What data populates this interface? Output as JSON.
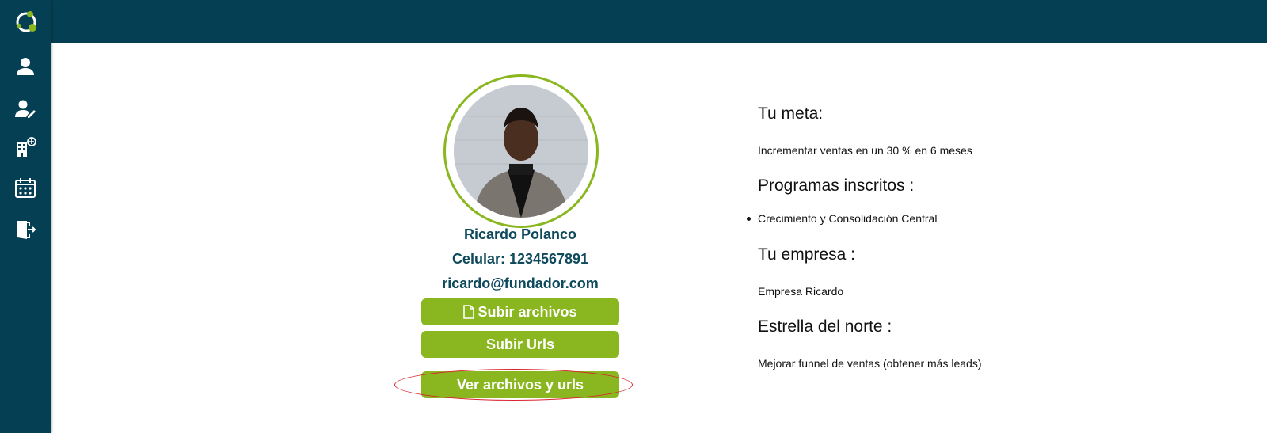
{
  "colors": {
    "brand_dark": "#053f53",
    "accent_green": "#8ab71f",
    "text_dark_teal": "#0e4a5c",
    "annotation_red": "#d9232b"
  },
  "sidebar": {
    "logo_icon": "circle-dots-logo",
    "items": [
      {
        "icon": "user-icon"
      },
      {
        "icon": "user-edit-icon"
      },
      {
        "icon": "building-add-icon"
      },
      {
        "icon": "calendar-icon"
      },
      {
        "icon": "logout-door-icon"
      }
    ]
  },
  "profile": {
    "name": "Ricardo Polanco",
    "phone": "Celular: 1234567891",
    "email": "ricardo@fundador.com",
    "buttons": {
      "upload_files": "Subir archivos",
      "upload_urls": "Subir Urls",
      "view_files_urls": "Ver archivos y urls"
    }
  },
  "info": {
    "goal_heading": "Tu meta:",
    "goal_value": "Incrementar ventas en un 30 % en 6 meses",
    "programs_heading": "Programas inscritos :",
    "programs": [
      "Crecimiento y Consolidación Central"
    ],
    "company_heading": "Tu empresa :",
    "company_value": "Empresa Ricardo",
    "north_star_heading": "Estrella del norte :",
    "north_star_value": "Mejorar funnel de ventas (obtener más leads)"
  }
}
